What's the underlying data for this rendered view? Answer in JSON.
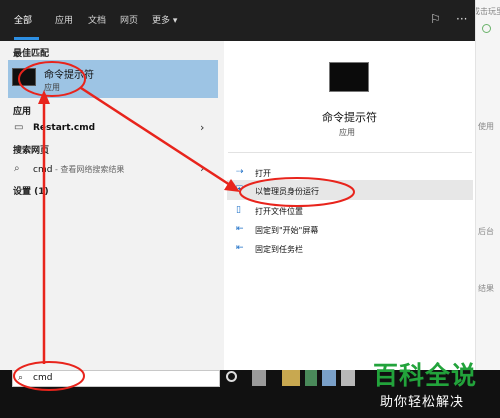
{
  "tabs": [
    "全部",
    "应用",
    "文档",
    "网页",
    "更多 ▾"
  ],
  "sections": {
    "best_match": "最佳匹配",
    "apps": "应用",
    "web": "搜索网页",
    "settings": "设置 (1)"
  },
  "best_match_item": {
    "title": "命令提示符",
    "subtitle": "应用"
  },
  "app_results": [
    {
      "name": "Restart.cmd"
    }
  ],
  "web_results": [
    {
      "query": "cmd",
      "suffix": " - 查看网络搜索结果"
    }
  ],
  "preview": {
    "title": "命令提示符",
    "type": "应用"
  },
  "actions": [
    "打开",
    "以管理员身份运行",
    "打开文件位置",
    "固定到\"开始\"屏幕",
    "固定到任务栏"
  ],
  "search": {
    "value": "cmd"
  },
  "background_text": [
    "成击玩里输入工具图标",
    "使用",
    "后台",
    "结果"
  ],
  "watermark": {
    "title": "百科全说",
    "subtitle": "助你轻松解决"
  },
  "colors": {
    "selected": "#9dc4e4",
    "accent": "#2d8fe3",
    "annotation": "#e8241c",
    "watermark": "#22a33b"
  }
}
